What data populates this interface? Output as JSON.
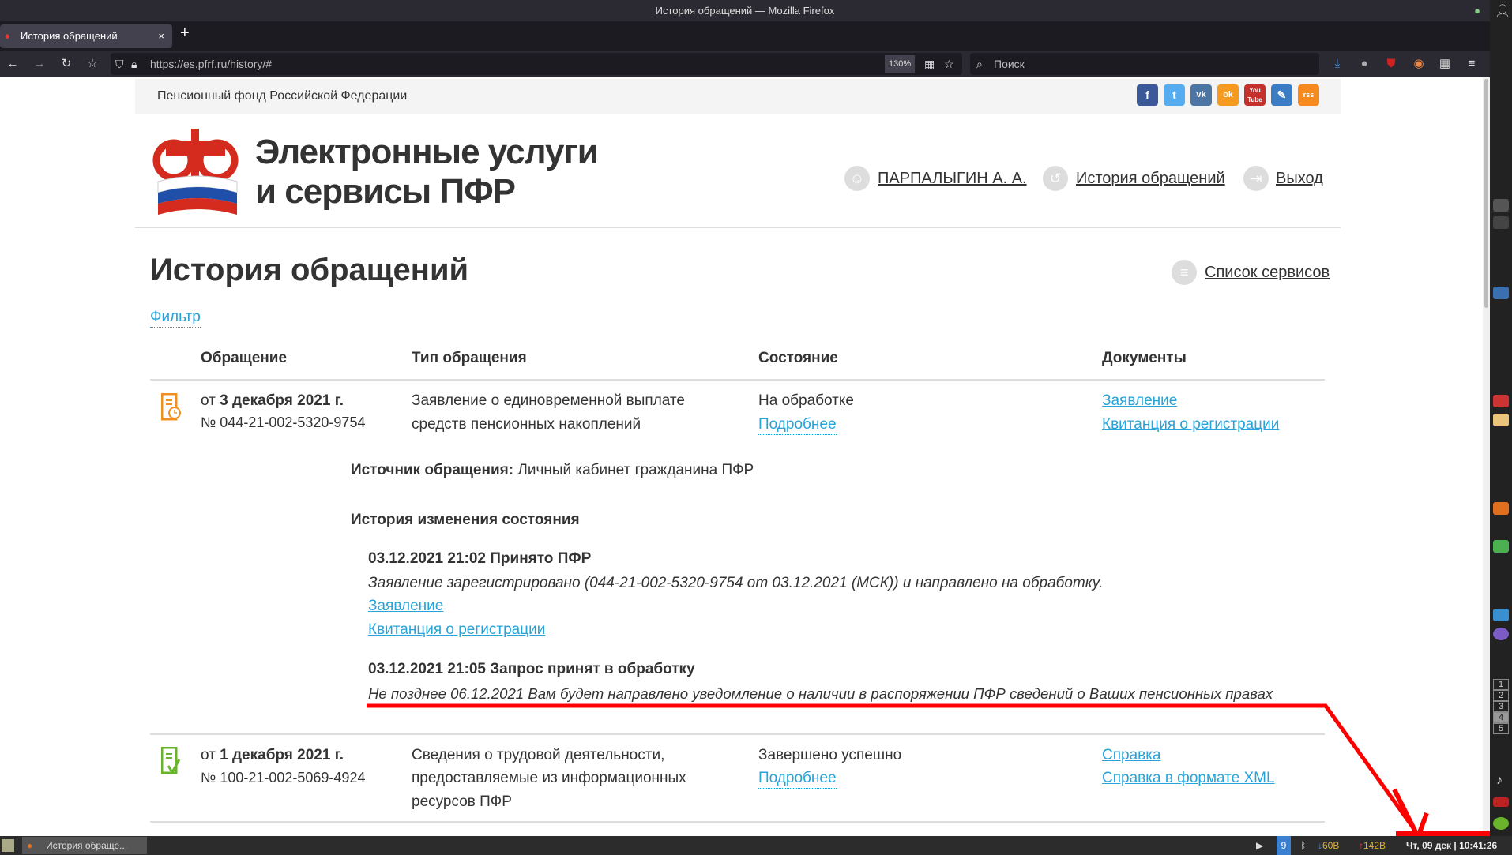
{
  "window": {
    "title": "История обращений — Mozilla Firefox"
  },
  "tab": {
    "label": "История обращений",
    "close": "×",
    "new_tab": "+"
  },
  "nav": {
    "url": "https://es.pfrf.ru/history/#",
    "zoom": "130%",
    "search_placeholder": "Поиск"
  },
  "site": {
    "org_name": "Пенсионный фонд Российской Федерации",
    "title_line1": "Электронные услуги",
    "title_line2": "и сервисы ПФР",
    "user": "ПАРПАЛЫГИН А. А.",
    "history_link": "История обращений",
    "logout": "Выход",
    "social": [
      "f",
      "t",
      "vk",
      "ok",
      "You Tube",
      "✎",
      "rss"
    ]
  },
  "page": {
    "heading": "История обращений",
    "services_link": "Список сервисов",
    "filter": "Фильтр"
  },
  "table": {
    "headers": [
      "Обращение",
      "Тип обращения",
      "Состояние",
      "Документы"
    ],
    "rows": [
      {
        "date_prefix": "от ",
        "date": "3 декабря 2021 г.",
        "number": "№ 044-21-002-5320-9754",
        "type_line1": "Заявление о единовременной выплате",
        "type_line2": "средств пенсионных накоплений",
        "status": "На обработке",
        "details": "Подробнее",
        "docs": [
          "Заявление",
          "Квитанция о регистрации"
        ],
        "source_label": "Источник обращения:",
        "source_value": " Личный кабинет гражданина ПФР",
        "history_heading": "История изменения состояния",
        "history": [
          {
            "title": "03.12.2021 21:02 Принято ПФР",
            "text": "Заявление зарегистрировано (044-21-002-5320-9754 от 03.12.2021 (МСК)) и направлено на обработку.",
            "links": [
              "Заявление",
              "Квитанция о регистрации"
            ]
          },
          {
            "title": "03.12.2021 21:05 Запрос принят в обработку",
            "text": "Не позднее 06.12.2021 Вам будет направлено уведомление о наличии в распоряжении ПФР сведений о Ваших пенсионных правах"
          }
        ]
      },
      {
        "date_prefix": "от ",
        "date": "1 декабря 2021 г.",
        "number": "№ 100-21-002-5069-4924",
        "type_line1": "Сведения о трудовой деятельности,",
        "type_line2": "предоставляемые из информационных",
        "type_line3": "ресурсов ПФР",
        "status": "Завершено успешно",
        "details": "Подробнее",
        "docs": [
          "Справка",
          "Справка в формате XML"
        ]
      }
    ]
  },
  "taskbar": {
    "window_label": "История обраще...",
    "down": "60B",
    "up": "142B",
    "clock": "Чт, 09 дек | 10:41:26",
    "workspaces": [
      "1",
      "2",
      "3",
      "4",
      "5"
    ],
    "badge": "9"
  },
  "colors": {
    "link": "#27a3d9",
    "annotation": "#ff0000",
    "orange": "#f0901e",
    "green": "#6ab42d"
  }
}
